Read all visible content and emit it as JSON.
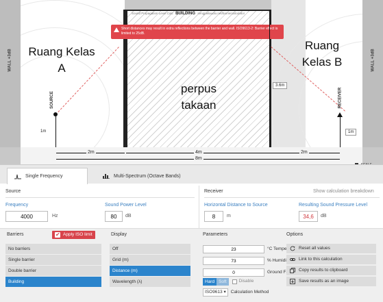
{
  "diagram": {
    "header_small": "Sound Propagation Level Calc",
    "header_bold": "BUILDING",
    "header_url": "sengpielaudio.net/barriercalculator",
    "warning": "Short distances may result in extra reflections between the barrier and wall. ISO9613-2: Barrier effect is limited to 25dB.",
    "wall_left": "WALL +3dB",
    "wall_right": "WALL +3dB",
    "room_a": "Ruang Kelas A",
    "room_b": "Ruang Kelas B",
    "building_text": "perpus takaan",
    "source_label": "SOURCE",
    "receiver_label": "RECEIVER",
    "source_height": "1m",
    "receiver_height": "1m",
    "building_height": "3.6m",
    "dist_left": "2m",
    "dist_building": "4m",
    "dist_total": "8m",
    "dist_right": "2m",
    "scale_label": "SCALE"
  },
  "tabs": [
    {
      "label": "Single Frequency",
      "icon": "pulse-icon",
      "active": true
    },
    {
      "label": "Multi-Spectrum (Octave Bands)",
      "icon": "bar-chart-icon",
      "active": false
    }
  ],
  "source": {
    "title": "Source",
    "frequency_label": "Frequency",
    "frequency_value": "4000",
    "frequency_unit": "Hz",
    "power_label": "Sound Power Level",
    "power_value": "80",
    "power_unit": "dB"
  },
  "receiver": {
    "title": "Receiver",
    "breakdown_link": "Show calculation breakdown",
    "distance_label": "Horizontal Distance to Source",
    "distance_value": "8",
    "distance_unit": "m",
    "result_label": "Resulting Sound Pressure Level",
    "result_value": "34,6",
    "result_unit": "dB"
  },
  "barriers": {
    "title": "Barriers",
    "iso_toggle": "Apply ISO limit",
    "items": [
      "No barriers",
      "Single barrier",
      "Double barrier",
      "Building"
    ],
    "selected": "Building"
  },
  "display": {
    "title": "Display",
    "items": [
      "Off",
      "Grid (m)",
      "Distance (m)",
      "Wavelength (λ)"
    ],
    "selected": "Distance (m)"
  },
  "parameters": {
    "title": "Parameters",
    "temperature_value": "23",
    "temperature_label": "°C Temperature",
    "humidity_value": "73",
    "humidity_label": "% Humidity",
    "ground_value": "0",
    "ground_label": "Ground Factor (G)",
    "hard_label": "Hard",
    "soft_label": "Soft",
    "disable_label": "Disable",
    "method_value": "ISO9613",
    "method_label": "Calculation Method"
  },
  "options": {
    "title": "Options",
    "items": [
      {
        "label": "Reset all values",
        "icon": "reset-icon"
      },
      {
        "label": "Link to this calculation",
        "icon": "link-icon"
      },
      {
        "label": "Copy results to clipboard",
        "icon": "copy-icon"
      },
      {
        "label": "Save results as an image",
        "icon": "save-image-icon"
      }
    ]
  },
  "colors": {
    "accent_blue": "#2b84cc",
    "alert_red": "#e0454b",
    "result_red": "#d0383e"
  }
}
